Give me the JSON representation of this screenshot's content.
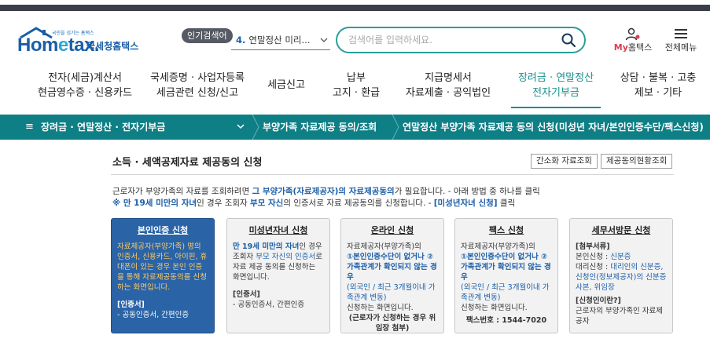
{
  "header": {
    "logo_tiny": "국민을 섬기는 홈택스",
    "logo_word_a": "Hom",
    "logo_word_e": "e",
    "logo_word_b": "tax.",
    "logo_ko": "국세청홈택스",
    "popular_label": "인기검색어",
    "popular_rank": "4.",
    "popular_text": "연말정산 미리...",
    "search_placeholder": "검색어를 입력하세요.",
    "myhome_my": "My",
    "myhome_rest": "홈택스",
    "allmenu_label": "전체메뉴"
  },
  "gnb": [
    {
      "line1": "전자(세금)계산서",
      "line2": "현금영수증 · 신용카드"
    },
    {
      "line1": "국세증명 · 사업자등록",
      "line2": "세금관련 신청/신고"
    },
    {
      "line1": "세금신고",
      "line2": ""
    },
    {
      "line1": "납부",
      "line2": "고지 · 환급"
    },
    {
      "line1": "지급명세서",
      "line2": "자료제출 · 공익법인"
    },
    {
      "line1": "장려금 · 연말정산",
      "line2": "전자기부금"
    },
    {
      "line1": "상담 · 불복 · 고충",
      "line2": "제보 · 기타"
    }
  ],
  "lnb": {
    "c1": "장려금 · 연말정산 · 전자기부금",
    "c2": "부양가족 자료제공 동의/조회",
    "c3": "연말정산 부양가족 자료제공 동의 신청(미성년 자녀/본인인증수단/팩스신청)"
  },
  "content": {
    "title": "소득 · 세액공제자료 제공동의 신청",
    "btn_simple": "간소화 자료조회",
    "btn_status": "제공동의현황조회",
    "desc1_a": "근로자가 부양가족의 자료를 조회하려면 ",
    "desc1_hl": "그 부양가족(자료제공자)의 자료제공동의",
    "desc1_b": "가 필요합니다. - 아래 방법 중 하나를 클릭",
    "desc2_hl1": "※ 만 19세 미만의 자녀",
    "desc2_a": "인 경우 조회자 ",
    "desc2_hl2": "부모 자신",
    "desc2_b": "의 인증서로 자료 제공동의를 신청합니다. - ",
    "desc2_hl3": "[미성년자녀 신청]",
    "desc2_c": " 클릭"
  },
  "cards": [
    {
      "title": "본인인증 신청",
      "body": "자료제공자(부양가족) 명의 인증서, 신용카드, 아이핀, 휴대폰이 있는 경우 본인 인증을 통해 자료제공동의를 신청하는 화면입니다.",
      "sub_title": "[인증서]",
      "sub_body": "- 공동인증서, 간편인증"
    },
    {
      "title": "미성년자녀 신청",
      "hl": "만 19세 미만의 자녀",
      "body_a": "인 경우 조회자 ",
      "hl2": "부모 자신의 인증서",
      "body_b": "로 자료 제공 동의를 신청하는 화면입니다.",
      "sub_title": "[인증서]",
      "sub_body": "- 공동인증서, 간편인증"
    },
    {
      "title": "온라인 신청",
      "body_a": "자료제공자(부양가족)의",
      "hl": "①본인인증수단이 없거나 ②가족관계가 확인되지 않는 경우",
      "hl_sub": "(외국인 / 최근 3개월이내 가족관계 변동)",
      "body_b": "신청하는 화면입니다.",
      "note": "(근로자가 신청하는 경우 위임장 첨부)"
    },
    {
      "title": "팩스 신청",
      "body_a": "자료제공자(부양가족)의",
      "hl": "①본인인증수단이 없거나 ②가족관계가 확인되지 않는 경우",
      "hl_sub": "(외국인 / 최근 3개월이내 가족관계 변동)",
      "body_b": "신청하는 화면입니다.",
      "fax": "팩스번호 : 1544-7020"
    },
    {
      "title": "세무서방문 신청",
      "sub1": "[첨부서류]",
      "l1a": "본인신청 : ",
      "l1b": "신분증",
      "l2a": "대리신청 : ",
      "l2b": "대리인의 신분증, 신청인(정보제공자)의 신분증 사본, 위임장",
      "sub2": "[신청인이란?]",
      "l3": "근로자의 부양가족인 자료제공자"
    }
  ]
}
